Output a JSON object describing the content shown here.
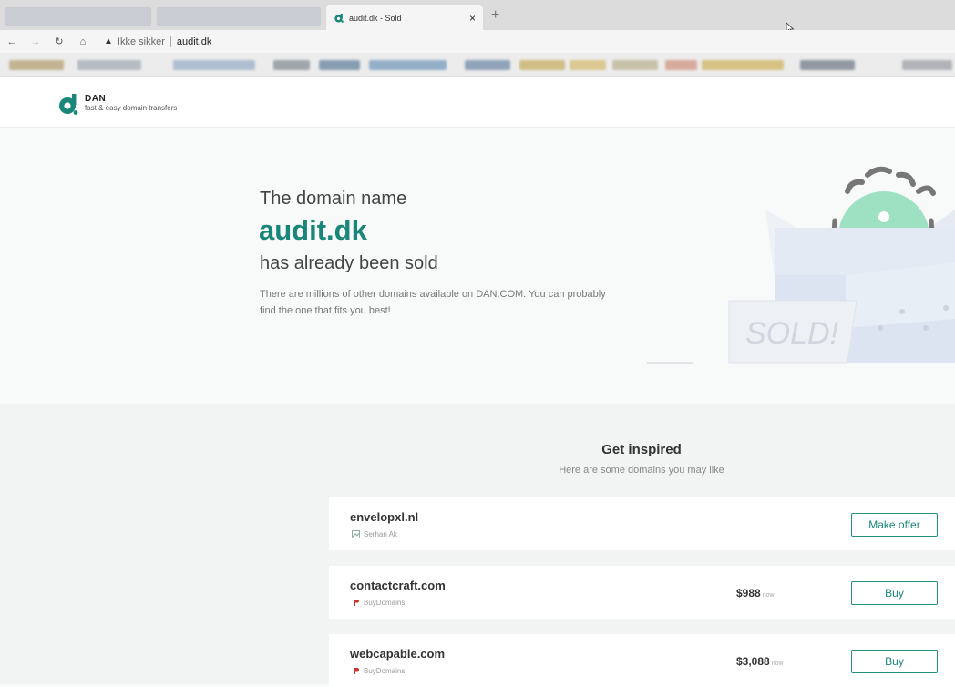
{
  "browser": {
    "tab_title": "audit.dk - Sold",
    "tab_close": "×",
    "new_tab": "+",
    "nav": {
      "back": "←",
      "forward": "→",
      "reload": "↻",
      "home": "⌂"
    },
    "security_label": "Ikke sikker",
    "url_host": "audit.dk"
  },
  "site": {
    "logo_name": "DAN",
    "logo_tagline": "fast & easy domain transfers"
  },
  "hero": {
    "line1": "The domain name",
    "domain": "audit.dk",
    "line2": "has already been sold",
    "description": "There are millions of other domains available on DAN.COM. You can probably find the one that fits you best!",
    "sold_text": "SOLD!"
  },
  "inspired": {
    "title": "Get inspired",
    "subtitle": "Here are some domains you may like",
    "domains": [
      {
        "name": "envelopxl.nl",
        "seller": "Serhan Ak",
        "price": "",
        "price_suffix": "",
        "action": "Make offer"
      },
      {
        "name": "contactcraft.com",
        "seller": "BuyDomains",
        "price": "$988",
        "price_suffix": "now",
        "action": "Buy"
      },
      {
        "name": "webcapable.com",
        "seller": "BuyDomains",
        "price": "$3,088",
        "price_suffix": "now",
        "action": "Buy"
      }
    ]
  },
  "colors": {
    "brand_teal": "#18877a",
    "mascot_green": "#9ee0c2",
    "tab_favicon": "#18877a"
  }
}
